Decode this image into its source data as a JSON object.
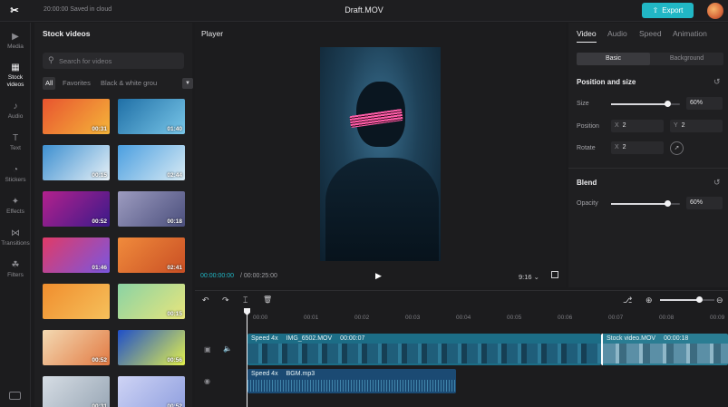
{
  "topbar": {
    "logo_glyph": "✂",
    "saved_text": "20:00:00 Saved in cloud",
    "title": "Draft.MOV",
    "export_label": "Export",
    "export_icon": "⇧"
  },
  "nav": {
    "items": [
      {
        "icon": "▶",
        "label": "Media"
      },
      {
        "icon": "▦",
        "label": "Stock videos"
      },
      {
        "icon": "♪",
        "label": "Audio"
      },
      {
        "icon": "T",
        "label": "Text"
      },
      {
        "icon": "◔",
        "label": "Stickers"
      },
      {
        "icon": "✦",
        "label": "Effects"
      },
      {
        "icon": "⋈",
        "label": "Transitions"
      },
      {
        "icon": "☘",
        "label": "Filters"
      }
    ]
  },
  "stock": {
    "title": "Stock videos",
    "search_placeholder": "Search for videos",
    "filters": [
      "All",
      "Favorites",
      "Black & white grou"
    ],
    "thumbs": [
      {
        "duration": "00:31",
        "c1": "#e8542f",
        "c2": "#f5b53a"
      },
      {
        "duration": "01:40",
        "c1": "#1f6fa6",
        "c2": "#79c6e8"
      },
      {
        "duration": "00:15",
        "c1": "#3d8fd0",
        "c2": "#e7f1f7"
      },
      {
        "duration": "02:44",
        "c1": "#4a9ee0",
        "c2": "#d9ebf4"
      },
      {
        "duration": "00:52",
        "c1": "#b3218d",
        "c2": "#3b1a8a"
      },
      {
        "duration": "00:18",
        "c1": "#9d9cc0",
        "c2": "#4b4f7d"
      },
      {
        "duration": "01:46",
        "c1": "#e03a67",
        "c2": "#7a57e0"
      },
      {
        "duration": "02:41",
        "c1": "#f08b3c",
        "c2": "#c94f24"
      },
      {
        "duration": "",
        "c1": "#f08e2e",
        "c2": "#f6c05b"
      },
      {
        "duration": "00:15",
        "c1": "#8ad3a4",
        "c2": "#e8e57c"
      },
      {
        "duration": "00:52",
        "c1": "#f3d9b2",
        "c2": "#e27a43"
      },
      {
        "duration": "00:56",
        "c1": "#1f4fc9",
        "c2": "#e2f04d"
      },
      {
        "duration": "00:31",
        "c1": "#d6dde4",
        "c2": "#98a6b5"
      },
      {
        "duration": "00:52",
        "c1": "#cfd4f5",
        "c2": "#8f9fdf"
      }
    ]
  },
  "player": {
    "title": "Player",
    "current_time": "00:00:00:00",
    "total_time": "/ 00:00:25:00",
    "play_icon": "▶",
    "ratio": "9:16 ⌄"
  },
  "props": {
    "tabs": [
      "Video",
      "Audio",
      "Speed",
      "Animation"
    ],
    "segments": [
      "Basic",
      "Background"
    ],
    "position_size_title": "Position and size",
    "size_label": "Size",
    "size_value": "60%",
    "size_fraction": 0.82,
    "position_label": "Position",
    "pos_x_axis": "X",
    "pos_x": "2",
    "pos_y_axis": "Y",
    "pos_y": "2",
    "rotate_label": "Rotate",
    "rotate_axis": "X",
    "rotate_value": "2",
    "blend_title": "Blend",
    "opacity_label": "Opacity",
    "opacity_value": "60%",
    "opacity_fraction": 0.82,
    "reset_icon": "↺"
  },
  "timeline": {
    "tools": [
      "↶",
      "↷",
      "⌶",
      "🗑"
    ],
    "ruler": [
      "00:00",
      "00:01",
      "00:02",
      "00:03",
      "00:04",
      "00:05",
      "00:06",
      "00:07",
      "00:08",
      "00:09"
    ],
    "zoom_fraction": 0.72,
    "video_clip_1": {
      "speed": "Speed 4x",
      "name": "IMG_6502.MOV",
      "time": "00:00:07"
    },
    "video_clip_2": {
      "speed": "",
      "name": "Stock video.MOV",
      "time": "00:00:18"
    },
    "audio_clip": {
      "speed": "Speed 4x",
      "name": "BGM.mp3"
    }
  },
  "colors": {
    "accent": "#21b7c5",
    "video_clip": "#1c6d86",
    "audio_clip": "#1b4a73"
  }
}
